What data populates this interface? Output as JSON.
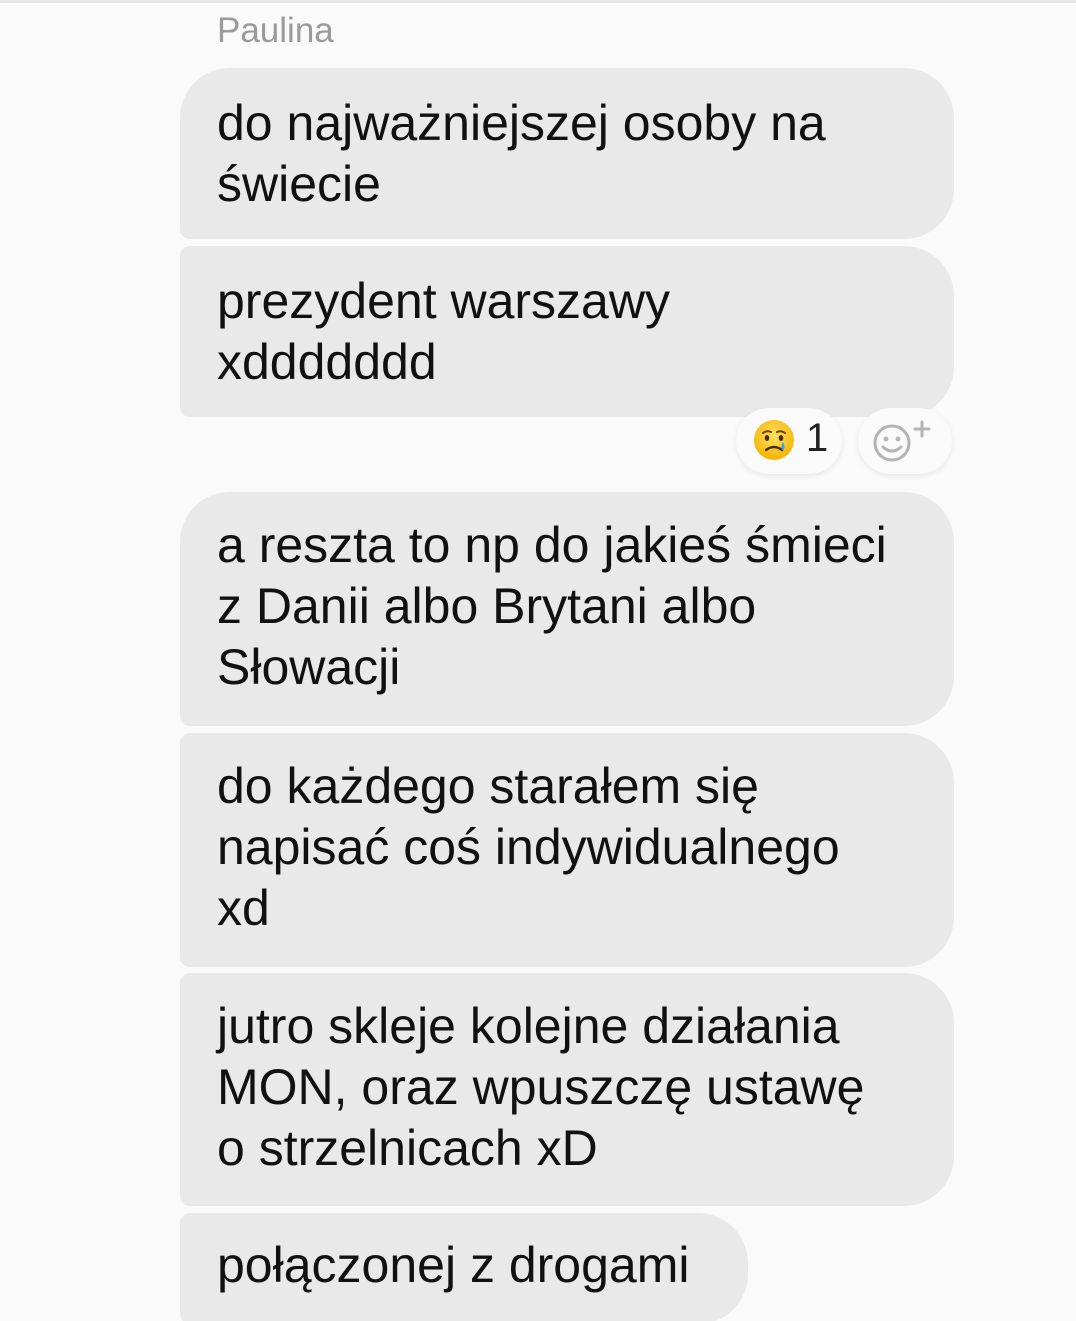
{
  "conversation": {
    "sender_name": "Paulina",
    "messages": [
      {
        "text": "do najważniejszej osoby na\nświecie"
      },
      {
        "text": "prezydent warszawy\nxddddddd"
      },
      {
        "text": "a reszta to np do jakieś śmieci\nz Danii albo Brytani albo\nSłowacji"
      },
      {
        "text": "do każdego starałem się\nnapisać coś indywidualnego\nxd"
      },
      {
        "text": "jutro skleje kolejne działania\nMON, oraz wpuszczę ustawę\no strzelnicach xD"
      },
      {
        "text": "połączonej z drogami"
      }
    ],
    "reaction": {
      "icon": "crying-face-icon",
      "count": "1"
    },
    "add_reaction_icon": "add-reaction-icon"
  },
  "colors": {
    "bubble_bg": "#e9e9e9",
    "page_bg": "#fafafa",
    "sender_text": "#9a9a9a",
    "message_text": "#111111"
  }
}
